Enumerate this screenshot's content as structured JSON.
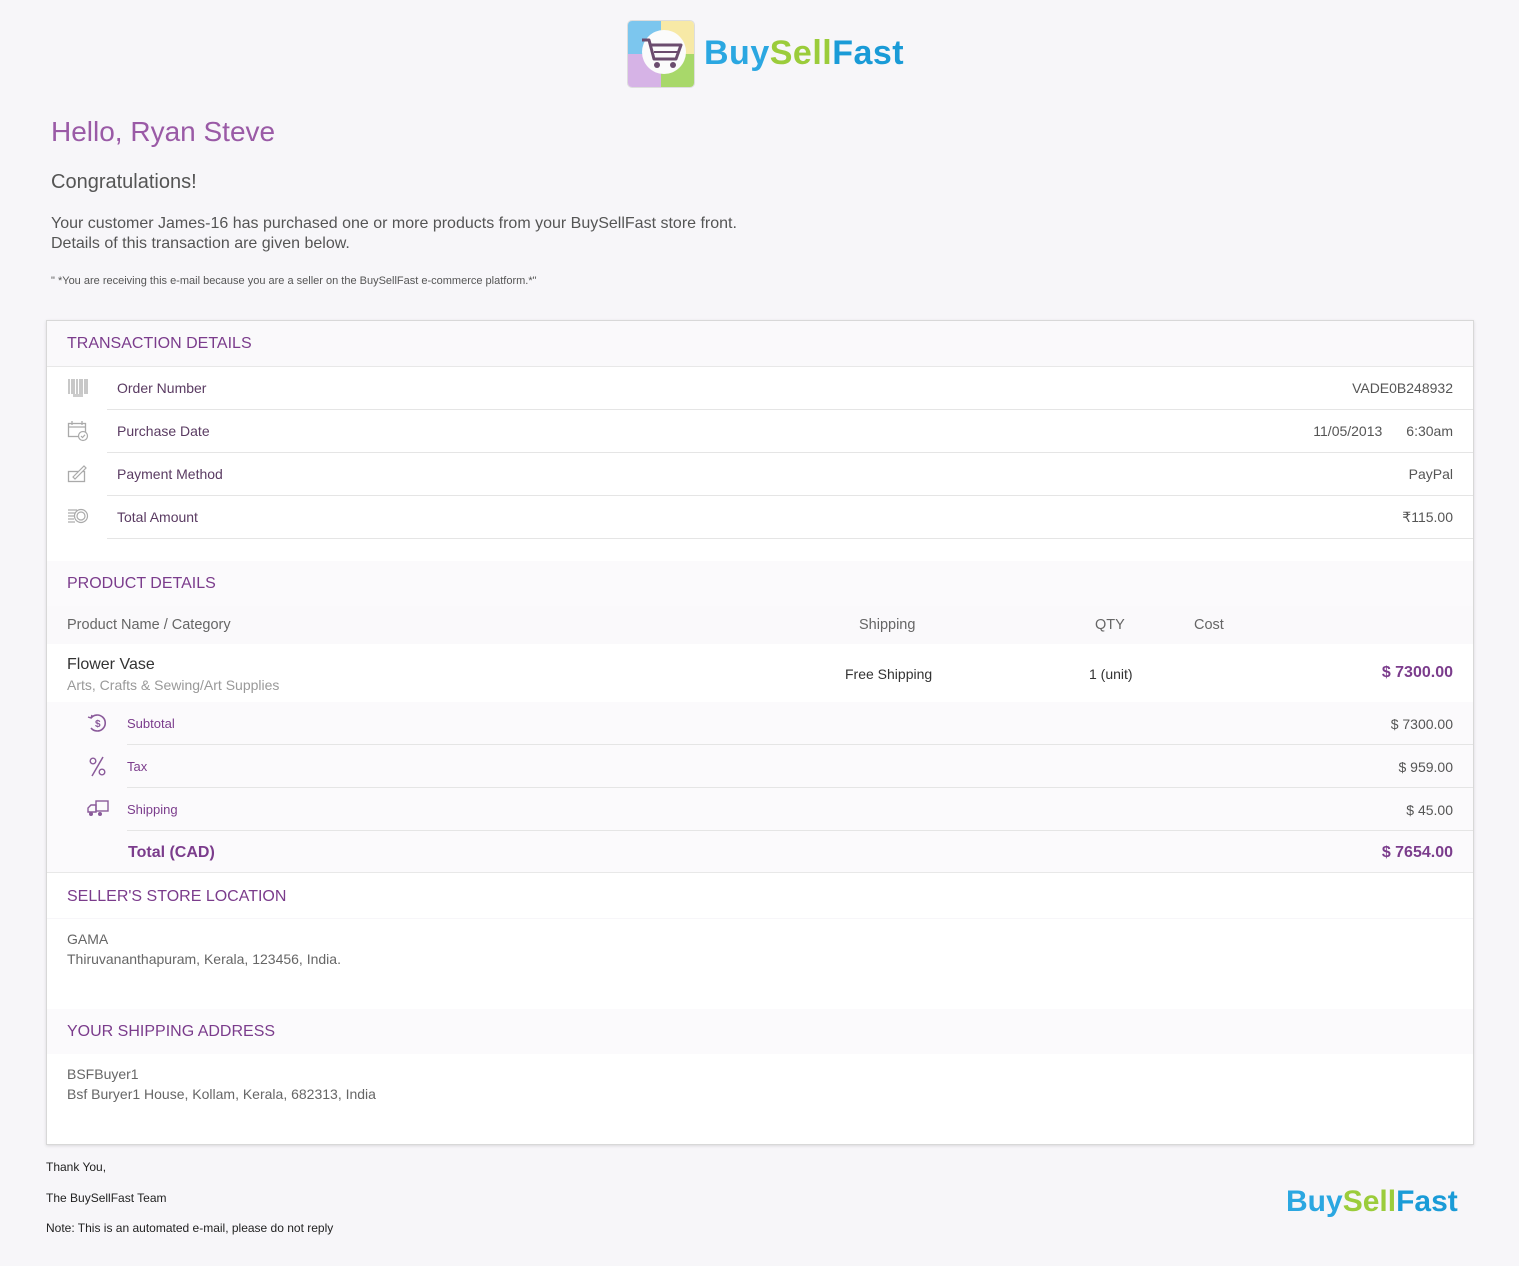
{
  "brand": {
    "logo_text_parts": [
      "Buy",
      "Sell",
      "Fast"
    ],
    "colors": {
      "buy": "#2ba7e1",
      "sell": "#9bcc3b",
      "fast": "#2ba7e1",
      "accent": "#7b3c8c",
      "greeting": "#9a5aa6"
    }
  },
  "greeting": "Hello, Ryan Steve",
  "congrats": "Congratulations!",
  "intro_line1": "Your customer James-16 has purchased one or more products from your BuySellFast store front.",
  "intro_line2": "Details of this transaction are given below.",
  "notice": "\" *You are receiving this e-mail because you are a seller on the BuySellFast e-commerce platform.*\"",
  "transaction": {
    "title": "TRANSACTION DETAILS",
    "rows": [
      {
        "icon": "barcode-icon",
        "label": "Order Number",
        "value": "VADE0B248932"
      },
      {
        "icon": "calendar-icon",
        "label": "Purchase Date",
        "date": "11/05/2013",
        "time": "6:30am"
      },
      {
        "icon": "payment-icon",
        "label": "Payment Method",
        "value": "PayPal"
      },
      {
        "icon": "coins-icon",
        "label": "Total Amount",
        "value": "₹115.00"
      }
    ]
  },
  "products": {
    "title": "PRODUCT DETAILS",
    "columns": {
      "name": "Product Name / Category",
      "shipping": "Shipping",
      "qty": "QTY",
      "cost": "Cost"
    },
    "items": [
      {
        "name": "Flower Vase",
        "category": "Arts, Crafts & Sewing/Art Supplies",
        "shipping": "Free Shipping",
        "qty": "1 (unit)",
        "cost": "$ 7300.00"
      }
    ],
    "summary": [
      {
        "icon": "subtotal-icon",
        "label": "Subtotal",
        "value": "$ 7300.00"
      },
      {
        "icon": "percent-icon",
        "label": "Tax",
        "value": "$ 959.00"
      },
      {
        "icon": "truck-icon",
        "label": "Shipping",
        "value": "$ 45.00"
      }
    ],
    "total_label": "Total (CAD)",
    "total_value": "$ 7654.00"
  },
  "seller_location": {
    "title": "SELLER'S STORE LOCATION",
    "name": "GAMA",
    "address": "Thiruvananthapuram, Kerala, 123456, India."
  },
  "shipping_address": {
    "title": "YOUR SHIPPING ADDRESS",
    "name": "BSFBuyer1",
    "address": "Bsf Buryer1 House, Kollam, Kerala, 682313, India"
  },
  "footer": {
    "thanks": "Thank You,",
    "team": "The BuySellFast Team",
    "note": "Note: This is an automated e-mail, please do not reply"
  }
}
